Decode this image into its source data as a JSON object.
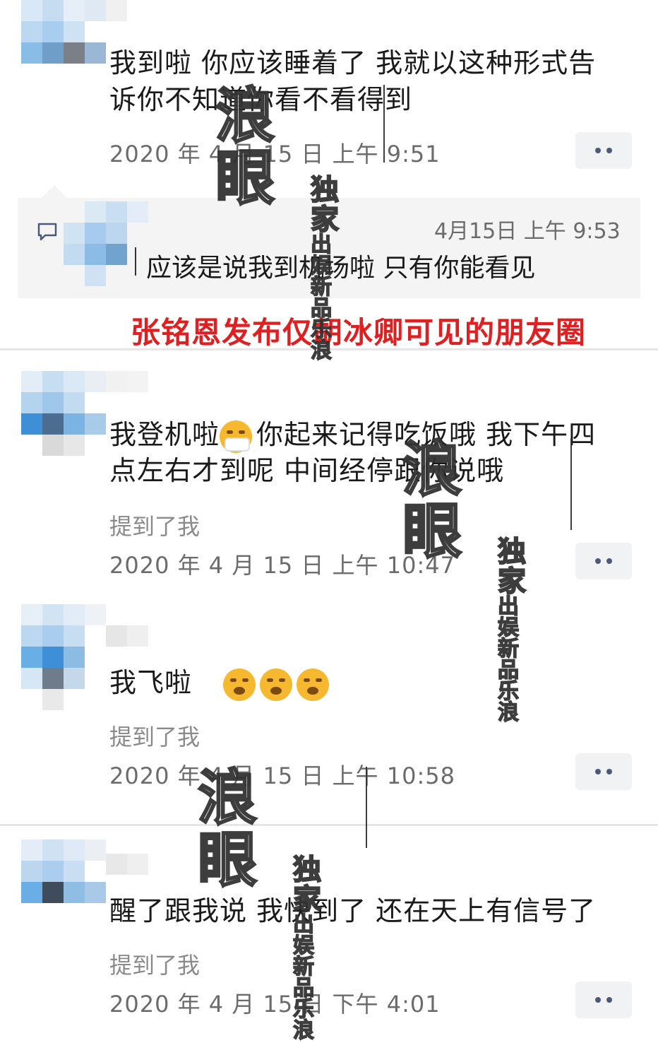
{
  "posts": [
    {
      "text_line1": "我到啦 你应该睡着了 我就以这种形式告",
      "text_line2": "诉你不知道你看不看得到",
      "timestamp": "2020 年 4 月 15 日 上午 9:51"
    },
    {
      "text_line1_a": "我登机啦",
      "text_line1_b": "你起来记得吃饭哦 我下午四",
      "text_line2": "点左右才到呢 中间经停跟你说哦",
      "mention": "提到了我",
      "timestamp": "2020 年 4 月 15 日 上午 10:47"
    },
    {
      "text": "我飞啦",
      "mention": "提到了我",
      "timestamp": "2020 年 4 月 15 日 上午 10:58"
    },
    {
      "text": "醒了跟我说 我快到了 还在天上有信号了",
      "mention": "提到了我",
      "timestamp": "2020 年 4 月 15 日 下午 4:01"
    }
  ],
  "comment": {
    "time": "4月15日 上午 9:53",
    "text": "应该是说我到机场啦 只有你能看见"
  },
  "caption": "张铭恩发布仅胡冰卿可见的朋友圈",
  "watermark": {
    "big1": "浪",
    "big2": "眼",
    "exclusive": "独家",
    "line1": "出娱新",
    "line2": "品乐浪"
  },
  "colors": {
    "caption_red": "#e02020",
    "more_button_bg": "#f1f2f4",
    "more_button_dots": "#4a5a78",
    "avatar_blue": "#2f86d4"
  },
  "icons": {
    "comment": "comment-bubble-icon",
    "more": "more-dots-icon",
    "emoji_mask": "face-with-medical-mask-emoji",
    "emoji_yawn": "yawning-face-emoji"
  }
}
